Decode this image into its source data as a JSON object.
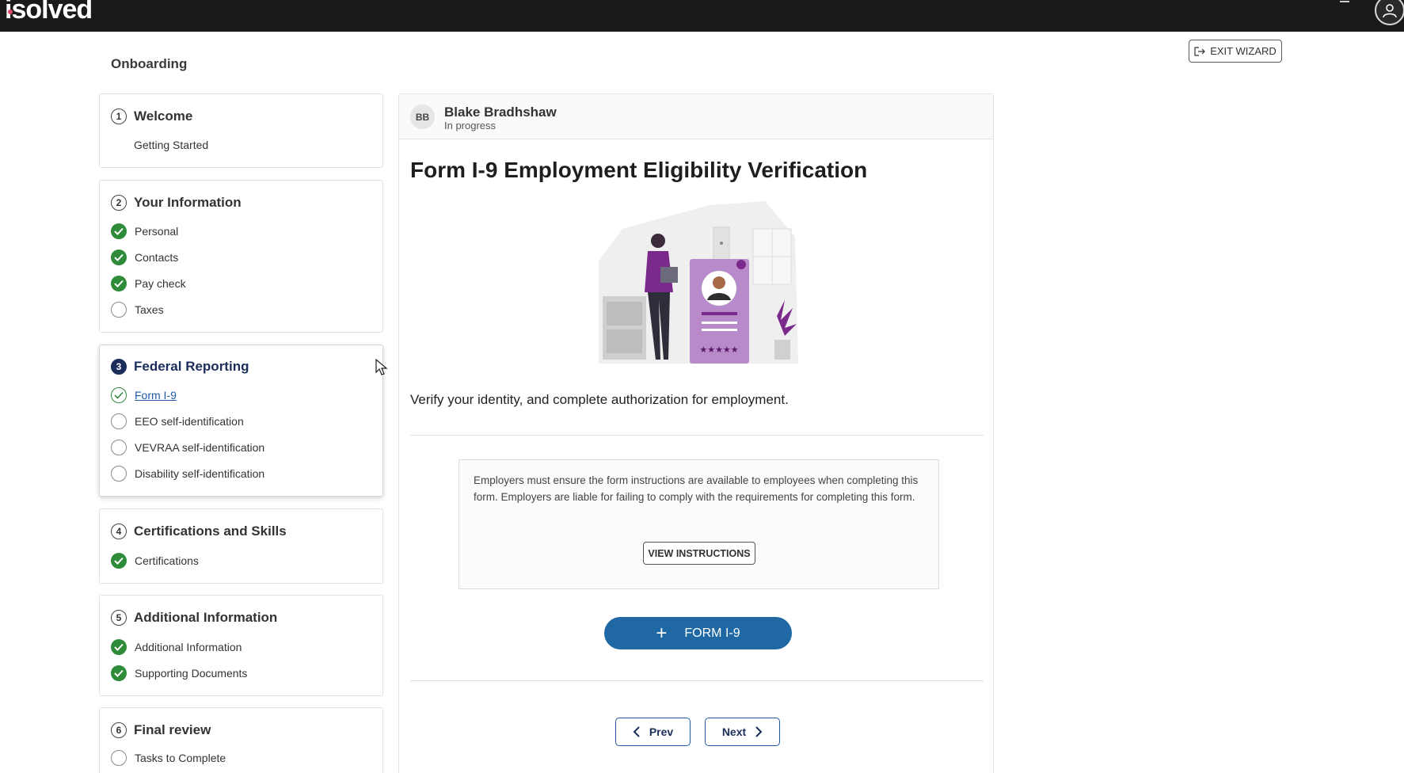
{
  "app": {
    "logo": "isolved",
    "user_icon": "user-avatar-icon"
  },
  "header": {
    "title": "Onboarding",
    "exit_label": "EXIT WIZARD",
    "exit_icon": "exit-icon"
  },
  "steps": [
    {
      "number": "1",
      "title": "Welcome",
      "items": [
        {
          "label": "Getting Started",
          "status": "none"
        }
      ]
    },
    {
      "number": "2",
      "title": "Your Information",
      "items": [
        {
          "label": "Personal",
          "status": "complete"
        },
        {
          "label": "Contacts",
          "status": "complete"
        },
        {
          "label": "Pay check",
          "status": "complete"
        },
        {
          "label": "Taxes",
          "status": "incomplete"
        }
      ]
    },
    {
      "number": "3",
      "title": "Federal Reporting",
      "active": true,
      "items": [
        {
          "label": "Form I-9",
          "status": "current"
        },
        {
          "label": "EEO self-identification",
          "status": "incomplete"
        },
        {
          "label": "VEVRAA self-identification",
          "status": "incomplete"
        },
        {
          "label": "Disability self-identification",
          "status": "incomplete"
        }
      ]
    },
    {
      "number": "4",
      "title": "Certifications and Skills",
      "items": [
        {
          "label": "Certifications",
          "status": "complete"
        }
      ]
    },
    {
      "number": "5",
      "title": "Additional Information",
      "items": [
        {
          "label": "Additional Information",
          "status": "complete"
        },
        {
          "label": "Supporting Documents",
          "status": "complete"
        }
      ]
    },
    {
      "number": "6",
      "title": "Final review",
      "items": [
        {
          "label": "Tasks to Complete",
          "status": "incomplete"
        }
      ]
    }
  ],
  "employee": {
    "initials": "BB",
    "name": "Blake Bradhshaw",
    "status": "In progress"
  },
  "form": {
    "title": "Form I-9 Employment Eligibility Verification",
    "description": "Verify your identity, and complete authorization for employment.",
    "notice": "Employers must ensure the form instructions are available to employees when completing this form. Employers are liable for failing to comply with the requirements for completing this form.",
    "view_instructions_label": "VIEW INSTRUCTIONS",
    "add_form_label": "FORM I-9"
  },
  "nav": {
    "prev_label": "Prev",
    "next_label": "Next"
  },
  "colors": {
    "accent": "#1f68a4",
    "complete": "#2e8b3a",
    "active_step": "#1b2d5a",
    "topbar": "#1a1a1a"
  }
}
